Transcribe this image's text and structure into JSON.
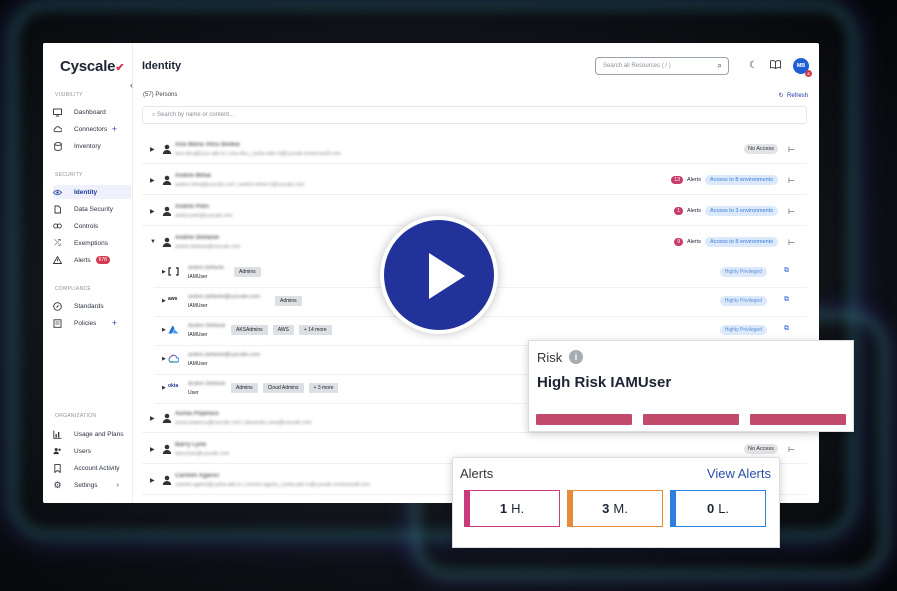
{
  "app": {
    "logo": "Cyscale",
    "page_title": "Identity"
  },
  "sidebar": {
    "sections": [
      {
        "label": "VISIBILITY",
        "items": [
          {
            "label": "Dashboard",
            "icon": "monitor-icon"
          },
          {
            "label": "Connectors",
            "icon": "cloud-icon",
            "plus": "+"
          },
          {
            "label": "Inventory",
            "icon": "database-icon"
          }
        ]
      },
      {
        "label": "SECURITY",
        "items": [
          {
            "label": "Identity",
            "icon": "eye-icon",
            "active": true
          },
          {
            "label": "Data Security",
            "icon": "data-icon"
          },
          {
            "label": "Controls",
            "icon": "controls-icon"
          },
          {
            "label": "Exemptions",
            "icon": "exemptions-icon"
          },
          {
            "label": "Alerts",
            "icon": "warning-icon",
            "badge": "678"
          }
        ]
      },
      {
        "label": "COMPLIANCE",
        "items": [
          {
            "label": "Standards",
            "icon": "compass-icon"
          },
          {
            "label": "Policies",
            "icon": "policies-icon",
            "plus": "+"
          }
        ]
      },
      {
        "label": "ORGANIZATION",
        "items": [
          {
            "label": "Usage and Plans",
            "icon": "chart-icon"
          },
          {
            "label": "Users",
            "icon": "users-icon"
          },
          {
            "label": "Account Activity",
            "icon": "bookmark-icon"
          },
          {
            "label": "Settings",
            "icon": "gear-icon",
            "chevron": "›"
          }
        ]
      }
    ]
  },
  "header": {
    "search_placeholder": "Search all Resources ( / )",
    "avatar_initials": "MB",
    "avatar_badge": "2"
  },
  "toolbar": {
    "count": "(57) Persons",
    "refresh": "Refresh",
    "search_placeholder": "Search by name or content..."
  },
  "persons": [
    {
      "name": "Ana Maria Vilcu Bodea",
      "email": "ana.vilcu@cysc-ade.io | ana.vilcu_cysha-ade-ro@cyscale.onmicrosoft.com",
      "status": "No Access"
    },
    {
      "name": "Andrei Mihai",
      "email": "andrei.mihai@cyscale.com | andrei.mihai+1@cyscale.com",
      "alerts_count": "13",
      "alerts_label": "Alerts",
      "access": "Access to 8 environments"
    },
    {
      "name": "Andrei Petri",
      "email": "andrei.petri@cyscale.com",
      "alerts_count": "1",
      "alerts_label": "Alerts",
      "access": "Access to 3 environments"
    },
    {
      "name": "Andrei Stefanie",
      "email": "andrei.stefanie@cyscale.com",
      "alerts_count": "9",
      "alerts_label": "Alerts",
      "access": "Access to 8 environments"
    },
    {
      "name": "Aurea Popescu",
      "email": "aurea.popescu@cyscale.com | alexandru.vona@cyscale.com"
    },
    {
      "name": "Barry Lyne",
      "email": "barry.lyne@cyscale.com",
      "status": "No Access"
    },
    {
      "name": "Carmen Agarici",
      "email": "carmen.agarici@cysha-ade.io | carmen.agarici_cysha-ade-ro@cyscale.onmicrosoft.com"
    }
  ],
  "identities": [
    {
      "provider": "aws-icon",
      "name": "andrei.stefanie",
      "type": "IAMUser",
      "tags": [
        "Admins"
      ],
      "privilege": "Highly Privileged"
    },
    {
      "provider": "aws",
      "name": "andrei.stefanie@cyscale.com",
      "type": "IAMUser",
      "tags": [
        "Admins"
      ],
      "privilege": "Highly Privileged"
    },
    {
      "provider": "azure-icon",
      "name": "Andrei Stefanie",
      "type": "IAMUser",
      "tags": [
        "AKSAdmins",
        "AWS",
        "+ 14 more"
      ],
      "privilege": "Highly Privileged"
    },
    {
      "provider": "gcp-icon",
      "name": "andrei.stefanie@cyscale.com",
      "type": "IAMUser",
      "tags": []
    },
    {
      "provider": "okta",
      "name": "Andrei Stefanie",
      "type": "User",
      "tags": [
        "Admins",
        "Cloud Admins",
        "+ 3 more"
      ]
    }
  ],
  "risk_card": {
    "label": "Risk",
    "info": "i",
    "headline": "High Risk IAMUser",
    "accent": "#c24a6a"
  },
  "alerts_card": {
    "label": "Alerts",
    "view_link": "View Alerts",
    "levels": [
      {
        "count": "1",
        "suffix": "H.",
        "color": "#c93b7a"
      },
      {
        "count": "3",
        "suffix": "M.",
        "color": "#e58b3a"
      },
      {
        "count": "0",
        "suffix": "L.",
        "color": "#2f7fe0"
      }
    ]
  }
}
